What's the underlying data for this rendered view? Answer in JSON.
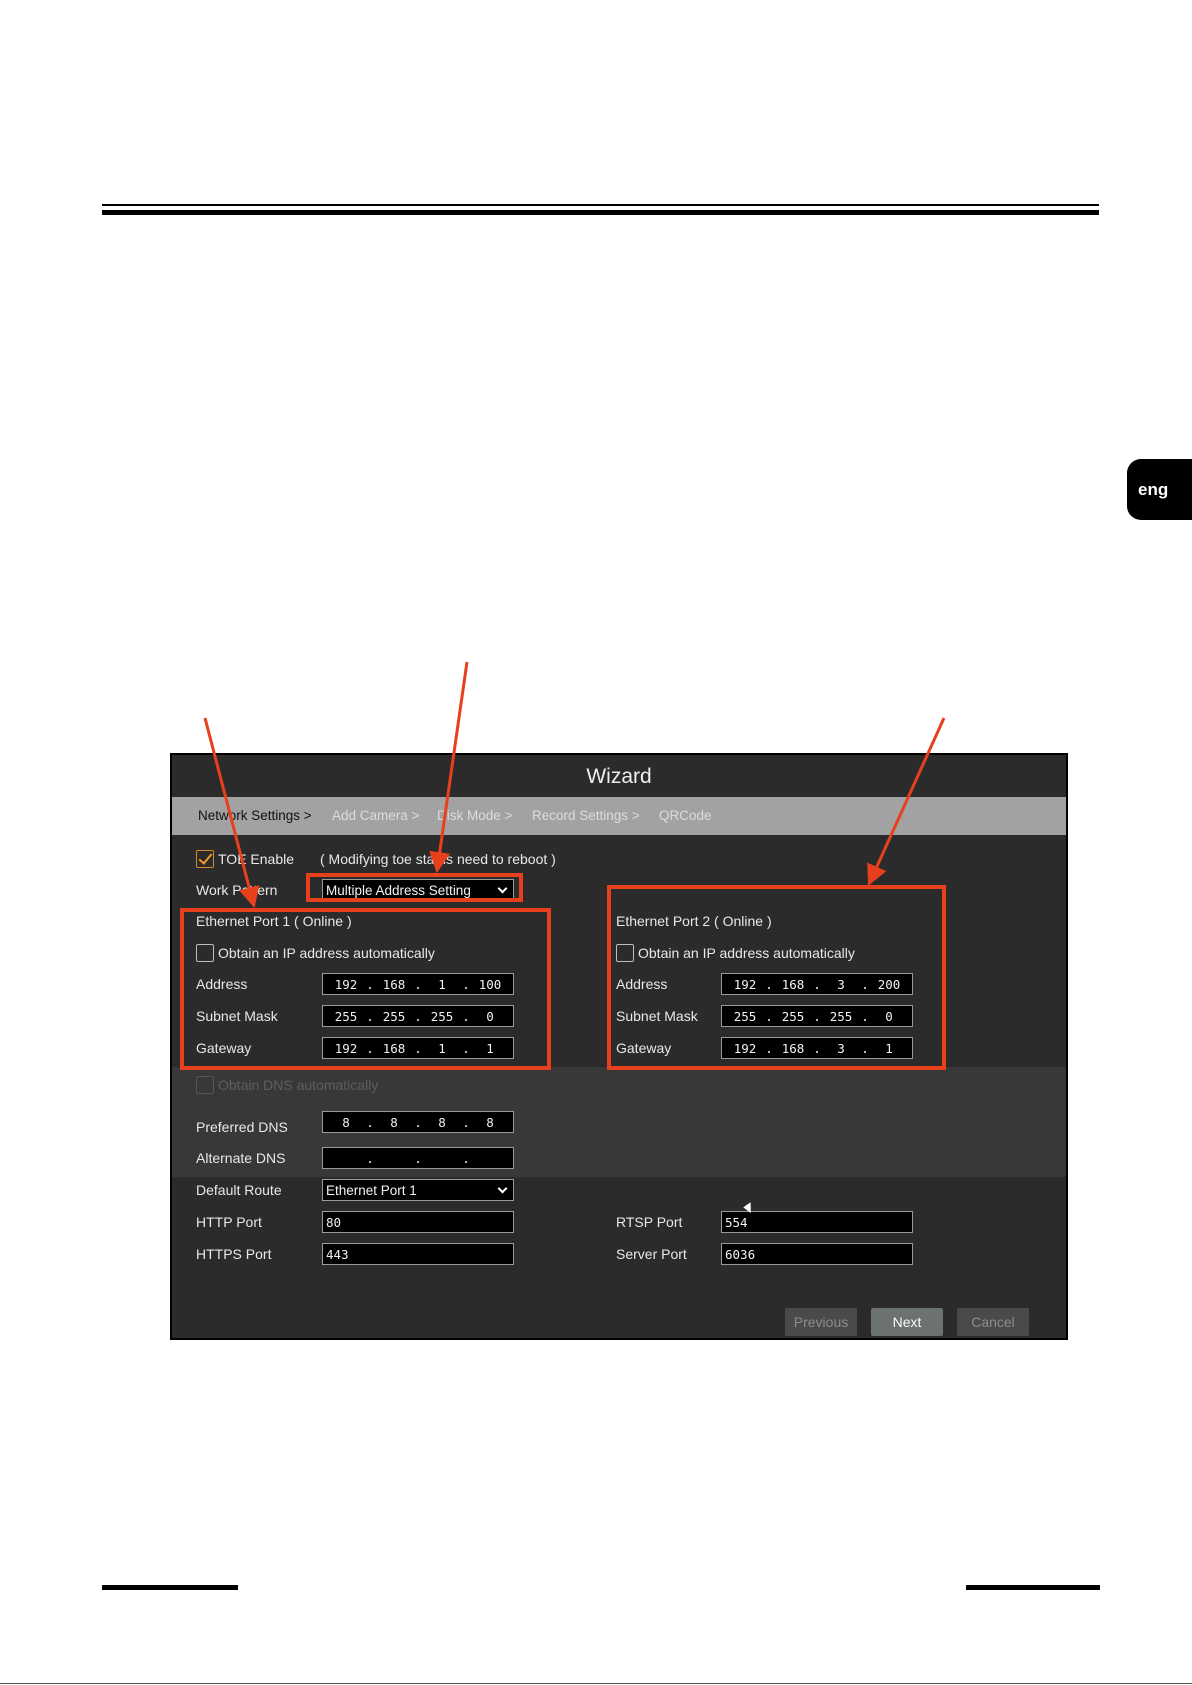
{
  "page": {
    "lang_tab": "eng"
  },
  "wizard": {
    "title": "Wizard",
    "steps": [
      {
        "label": "Network Settings >",
        "active": true
      },
      {
        "label": "Add Camera >",
        "active": false
      },
      {
        "label": "Disk Mode >",
        "active": false
      },
      {
        "label": "Record Settings >",
        "active": false
      },
      {
        "label": "QRCode",
        "active": false
      }
    ],
    "toe": {
      "label": "TOE Enable",
      "checked": true,
      "note": "( Modifying toe status need to reboot )"
    },
    "work_pattern": {
      "label": "Work Pattern",
      "value": "Multiple Address Setting"
    },
    "port1": {
      "title": "Ethernet Port 1 ( Online )",
      "auto_label": "Obtain an IP address automatically",
      "address_label": "Address",
      "address": [
        "192",
        "168",
        "1",
        "100"
      ],
      "mask_label": "Subnet Mask",
      "mask": [
        "255",
        "255",
        "255",
        "0"
      ],
      "gateway_label": "Gateway",
      "gateway": [
        "192",
        "168",
        "1",
        "1"
      ]
    },
    "port2": {
      "title": "Ethernet Port 2 ( Online )",
      "auto_label": "Obtain an IP address automatically",
      "address_label": "Address",
      "address": [
        "192",
        "168",
        "3",
        "200"
      ],
      "mask_label": "Subnet Mask",
      "mask": [
        "255",
        "255",
        "255",
        "0"
      ],
      "gateway_label": "Gateway",
      "gateway": [
        "192",
        "168",
        "3",
        "1"
      ]
    },
    "dns": {
      "auto_label": "Obtain DNS automatically",
      "preferred_label": "Preferred DNS",
      "preferred": [
        "8",
        "8",
        "8",
        "8"
      ],
      "alternate_label": "Alternate DNS",
      "alternate": [
        "",
        "",
        "",
        ""
      ]
    },
    "default_route": {
      "label": "Default Route",
      "value": "Ethernet Port 1"
    },
    "http": {
      "label": "HTTP Port",
      "value": "80"
    },
    "https": {
      "label": "HTTPS Port",
      "value": "443"
    },
    "rtsp": {
      "label": "RTSP Port",
      "value": "554"
    },
    "server": {
      "label": "Server Port",
      "value": "6036"
    },
    "buttons": {
      "previous": "Previous",
      "next": "Next",
      "cancel": "Cancel"
    }
  },
  "colors": {
    "annotation": "#e8401c",
    "checkbox_accent": "#f09a2b",
    "panel": "#2b2b2b",
    "step_bar": "#a2a2a2"
  }
}
